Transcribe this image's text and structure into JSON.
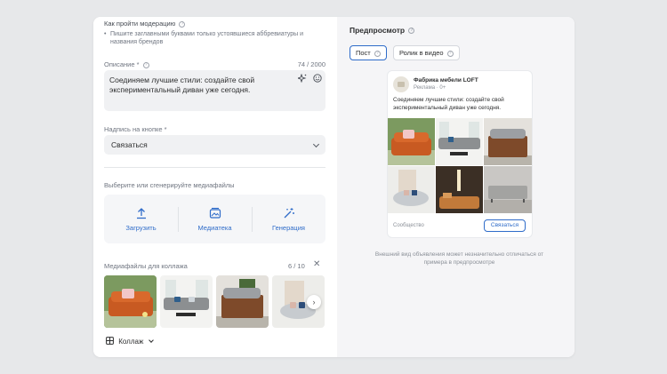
{
  "left": {
    "moderation_title": "Как пройти модерацию",
    "moderation_hint": "Пишите заглавными буквами только устоявшиеся аббревиатуры и названия брендов",
    "description_label": "Описание *",
    "description_counter": "74 / 2000",
    "description_value": "Соединяем лучшие стили: создайте свой экспериментальный диван уже сегодня.",
    "button_label_title": "Надпись на кнопке *",
    "button_label_value": "Связаться",
    "media_title": "Выберите или сгенерируйте медиафайлы",
    "upload_items": [
      {
        "label": "Загрузить",
        "icon": "upload-icon"
      },
      {
        "label": "Медиатека",
        "icon": "gallery-icon"
      },
      {
        "label": "Генерация",
        "icon": "magic-wand-icon"
      }
    ],
    "collage_media_title": "Медиафайлы для коллажа",
    "collage_counter": "6 / 10",
    "collage_button": "Коллаж"
  },
  "right": {
    "preview_title": "Предпросмотр",
    "tabs": [
      {
        "label": "Пост",
        "active": true
      },
      {
        "label": "Ролик в видео",
        "active": false
      }
    ],
    "post": {
      "brand": "Фабрика мебели LOFT",
      "meta": "Реклама · 0+",
      "text": "Соединяем лучшие стили: создайте свой экспериментальный диван уже сегодня.",
      "footer_label": "Сообщество",
      "cta": "Связаться"
    },
    "note": "Внешний вид объявления может незначительно отличаться от примера в предпросмотре"
  },
  "colors": {
    "accent": "#2f6cc9",
    "background": "#e7e8ea",
    "panel": "#f5f5f7"
  }
}
